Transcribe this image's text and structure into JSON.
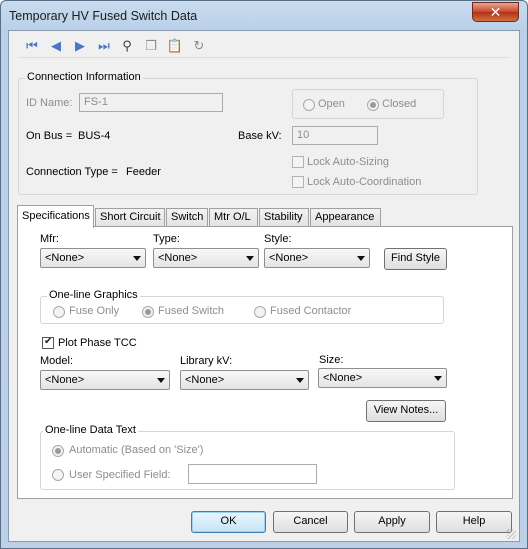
{
  "window": {
    "title": "Temporary HV Fused Switch Data",
    "close_glyph": "✕"
  },
  "toolbar": {
    "icons": [
      "first-record-icon",
      "prev-record-icon",
      "next-record-icon",
      "last-record-icon",
      "find-icon",
      "copy-icon",
      "paste-icon",
      "undo-icon"
    ]
  },
  "connection": {
    "title": "Connection Information",
    "id_label": "ID Name:",
    "id_value": "FS-1",
    "open_label": "Open",
    "closed_label": "Closed",
    "on_bus_label": "On Bus =",
    "on_bus_value": "BUS-4",
    "base_kv_label": "Base kV:",
    "base_kv_value": "10",
    "conn_type_label": "Connection Type =",
    "conn_type_value": "Feeder",
    "lock_sizing": "Lock Auto-Sizing",
    "lock_coord": "Lock Auto-Coordination"
  },
  "tabs": [
    "Specifications",
    "Short Circuit",
    "Switch",
    "Mtr O/L",
    "Stability",
    "Appearance"
  ],
  "specs": {
    "mfr_label": "Mfr:",
    "mfr_value": "<None>",
    "type_label": "Type:",
    "type_value": "<None>",
    "style_label": "Style:",
    "style_value": "<None>",
    "find_style": "Find Style",
    "oneline_title": "One-line Graphics",
    "fuse_only": "Fuse Only",
    "fused_switch": "Fused Switch",
    "fused_contactor": "Fused Contactor",
    "plot_tcc": "Plot Phase TCC",
    "model_label": "Model:",
    "model_value": "<None>",
    "libkv_label": "Library kV:",
    "libkv_value": "<None>",
    "size_label": "Size:",
    "size_value": "<None>",
    "view_notes": "View Notes...",
    "datatext_title": "One-line Data Text",
    "automatic": "Automatic (Based on 'Size')",
    "user_field": "User Specified Field:",
    "user_field_value": ""
  },
  "buttons": {
    "ok": "OK",
    "cancel": "Cancel",
    "apply": "Apply",
    "help": "Help"
  }
}
